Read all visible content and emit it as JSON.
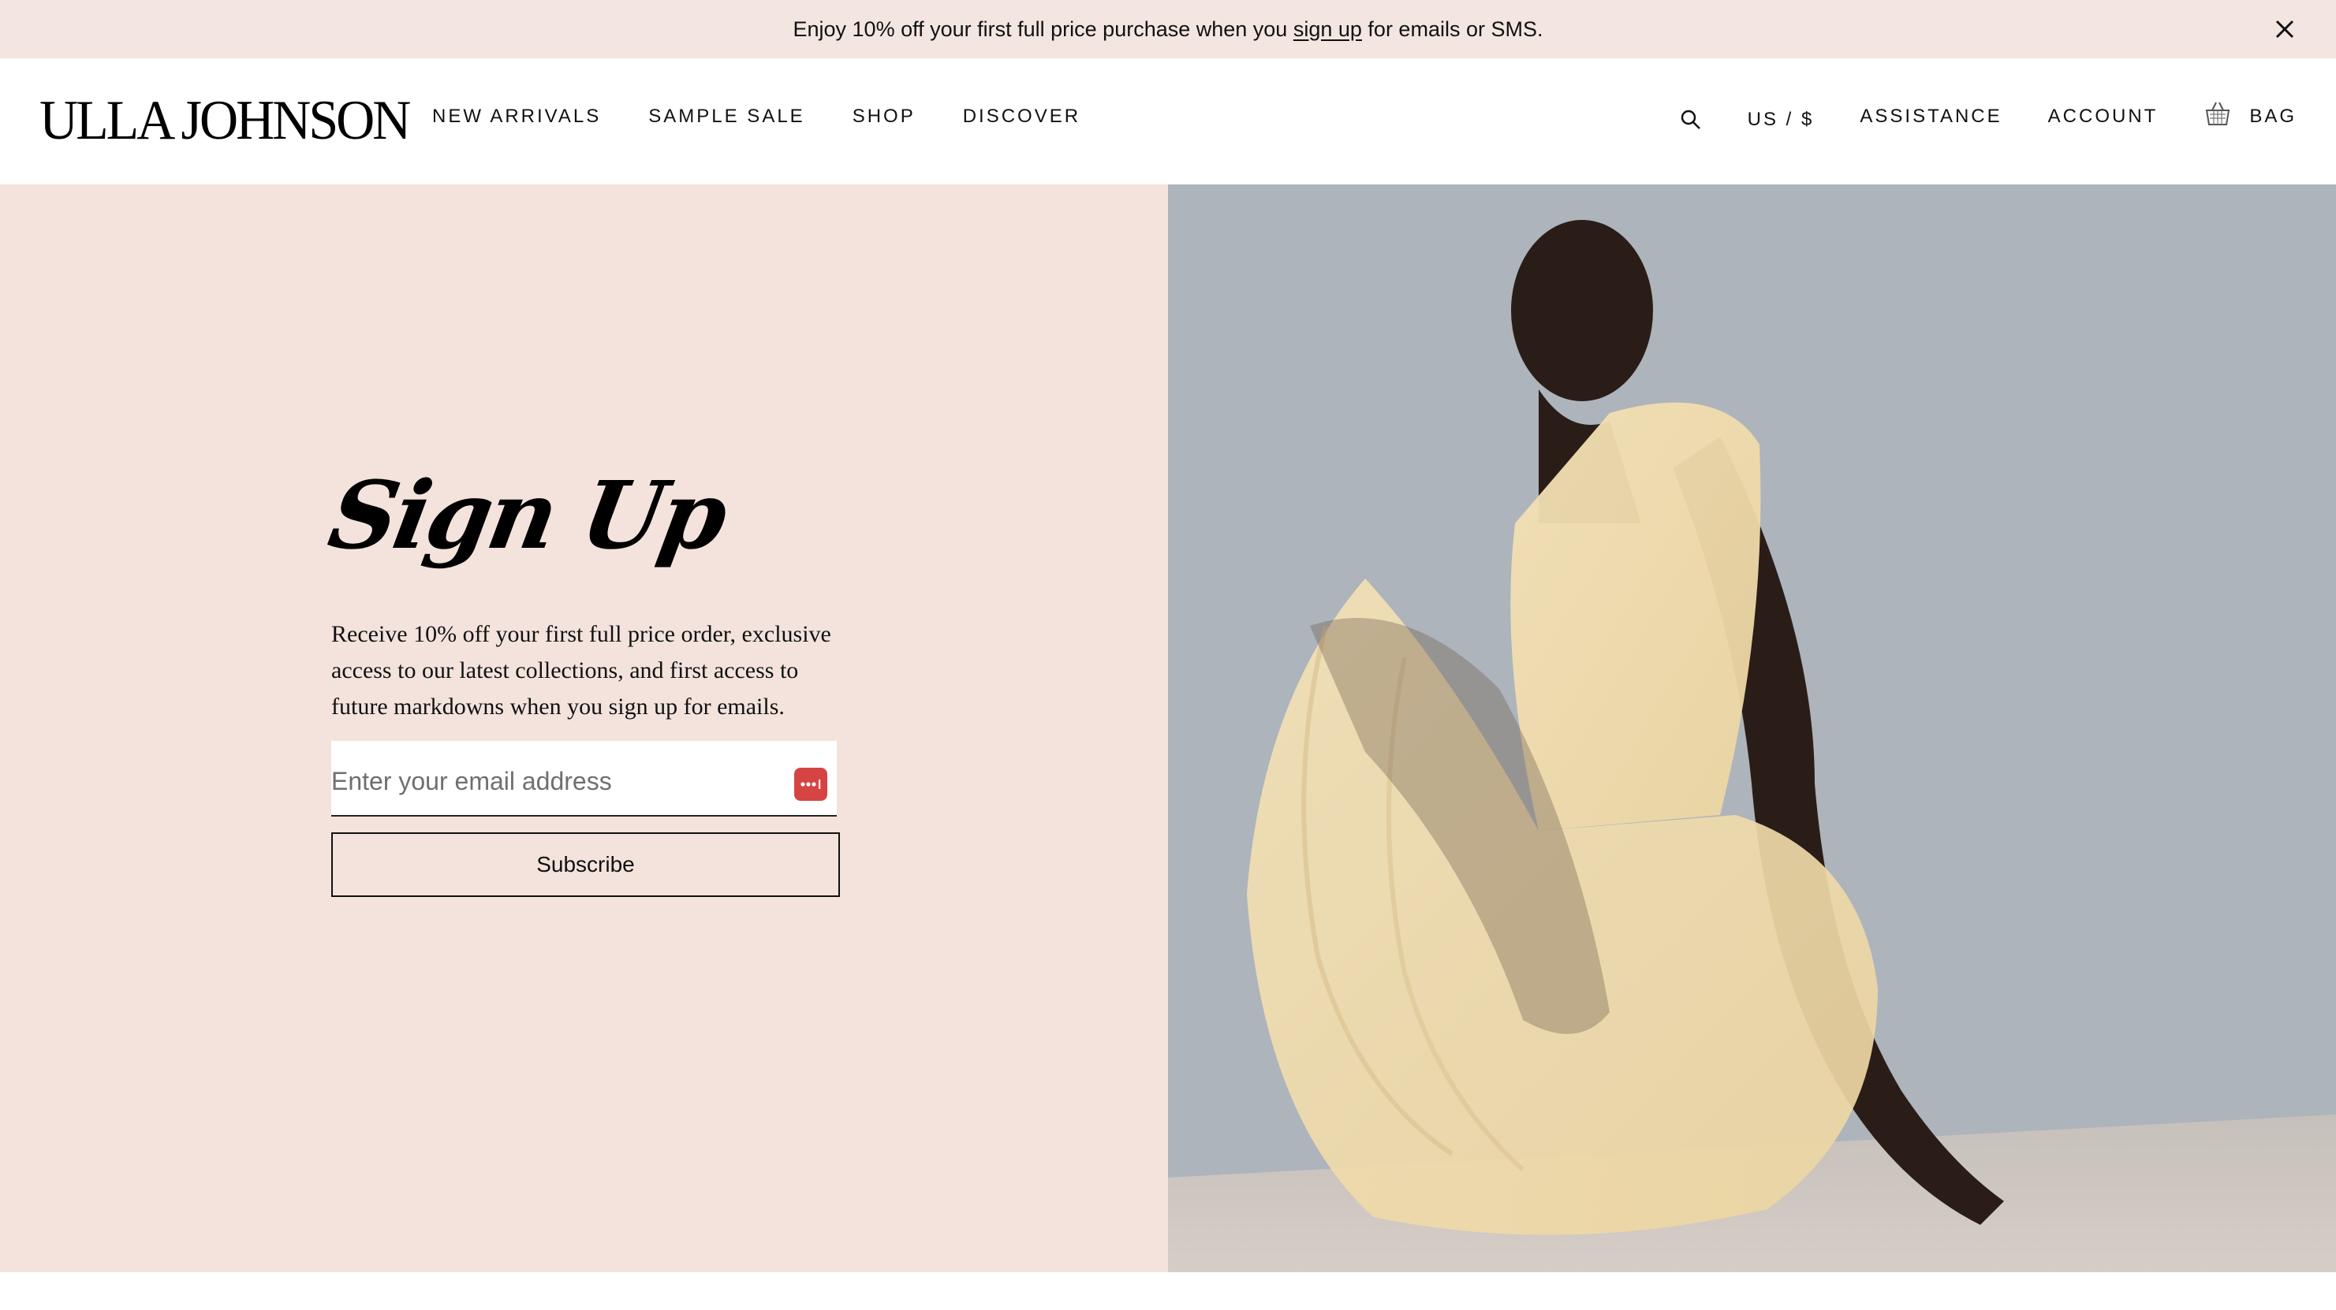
{
  "promo": {
    "text_before": "Enjoy 10% off your first full price purchase when you ",
    "link": "sign up",
    "text_after": " for emails or SMS.",
    "close_icon": "close-icon"
  },
  "header": {
    "logo": "ULLA JOHNSON",
    "nav": [
      "NEW ARRIVALS",
      "SAMPLE SALE",
      "SHOP",
      "DISCOVER"
    ],
    "search_icon": "search-icon",
    "region": "US / $",
    "assistance": "ASSISTANCE",
    "account": "ACCOUNT",
    "bag_icon": "bag-icon",
    "bag": "BAG"
  },
  "signup": {
    "title": "Sign Up",
    "description": "Receive 10% off your first full price order, exclusive access to our latest collections, and first access to future markdowns when you sign up for emails.",
    "email_placeholder": "Enter your email address",
    "subscribe_label": "Subscribe"
  },
  "colors": {
    "promo_bg": "#f3e6e1",
    "hero_left_bg": "#f3e3dc",
    "password_icon": "#d64343"
  }
}
